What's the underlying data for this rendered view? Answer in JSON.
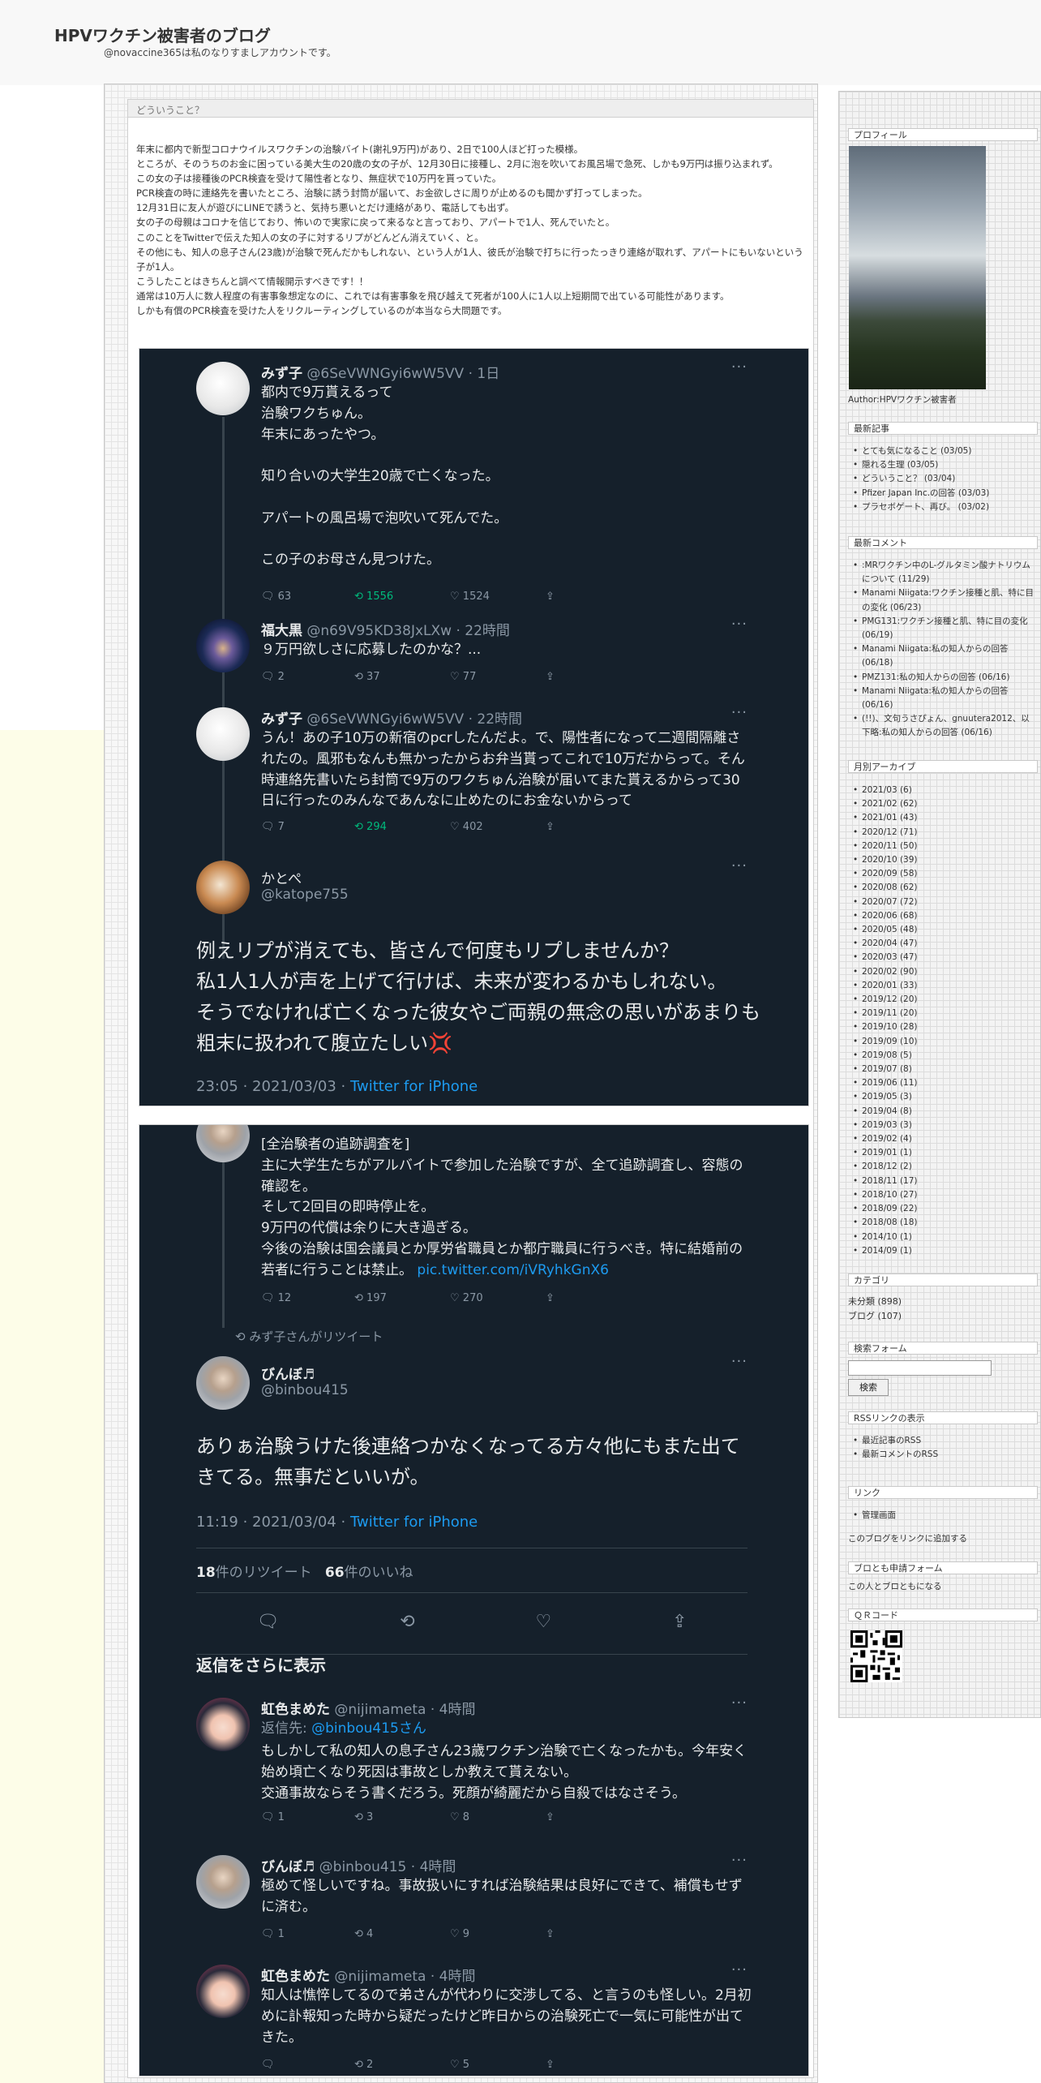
{
  "site": {
    "title": "HPVワクチン被害者のブログ",
    "subtitle": "@novaccine365は私のなりすましアカウントです。"
  },
  "entry": {
    "title": "どういうこと？",
    "paragraphs": [
      "年末に都内で新型コロナウイルスワクチンの治験バイト(謝礼9万円)があり、2日で100人ほど打った模様。",
      "ところが、そのうちのお金に困っている美大生の20歳の女の子が、12月30日に接種し、2月に泡を吹いてお風呂場で急死、しかも9万円は振り込まれず。",
      "この女の子は接種後のPCR検査を受けて陽性者となり、無症状で10万円を貰っていた。",
      "PCR検査の時に連絡先を書いたところ、治験に誘う封筒が届いて、お金欲しさに周りが止めるのも聞かず打ってしまった。",
      "12月31日に友人が遊びにLINEで誘うと、気持ち悪いとだけ連絡があり、電話しても出ず。",
      "女の子の母親はコロナを信じており、怖いので実家に戻って来るなと言っており、アパートで1人、死んでいたと。",
      "このことをTwitterで伝えた知人の女の子に対するリプがどんどん消えていく、と。",
      "その他にも、知人の息子さん(23歳)が治験で死んだかもしれない、という人が1人、彼氏が治験で打ちに行ったっきり連絡が取れず、アパートにもいないという子が1人。",
      "こうしたことはきちんと調べて情報開示すべきです！！",
      "通常は10万人に数人程度の有害事象想定なのに、これでは有害事象を飛び越えて死者が100人に1人以上短期間で出ている可能性があります。",
      "しかも有償のPCR検査を受けた人をリクルーティングしているのが本当なら大問題です。"
    ]
  },
  "shot1": {
    "t1": {
      "name": "みず子",
      "handle": "@6SeVWNGyi6wW5VV",
      "time": "· 1日",
      "text": "都内で9万貰えるって\n治験ワクちゅん。\n年末にあったやつ。\n\n知り合いの大学生20歳で亡くなった。\n\nアパートの風呂場で泡吹いて死んでた。\n\nこの子のお母さん見つけた。",
      "replies": "63",
      "retweets": "1556",
      "likes": "1524"
    },
    "t2": {
      "name": "福大黒",
      "handle": "@n69V95KD38JxLXw",
      "time": "· 22時間",
      "text": "９万円欲しさに応募したのかな？...",
      "replies": "2",
      "retweets": "37",
      "likes": "77"
    },
    "t3": {
      "name": "みず子",
      "handle": "@6SeVWNGyi6wW5VV",
      "time": "· 22時間",
      "text": "うん！あの子10万の新宿のpcrしたんだよ。で、陽性者になって二週間隔離されたの。風邪もなんも無かったからお弁当貰ってこれで10万だからって。そん時連絡先書いたら封筒で9万のワクちゅん治験が届いてまた貰えるからって30日に行ったのみんなであんなに止めたのにお金ないからって",
      "replies": "7",
      "retweets": "294",
      "likes": "402"
    },
    "main": {
      "name": "かとぺ",
      "handle": "@katope755",
      "text": "例えリプが消えても、皆さんで何度もリプしませんか？\n私1人1人が声を上げて行けば、未来が変わるかもしれない。\nそうでなければ亡くなった彼女やご両親の無念の思いがあまりも粗末に扱われて腹立たしい💢",
      "timestamp": "23:05 · 2021/03/03 · ",
      "source": "Twitter for iPhone"
    }
  },
  "shot2": {
    "t1": {
      "text": "[全治験者の追跡調査を]\n主に大学生たちがアルバイトで参加した治験ですが、全て追跡調査し、容態の確認を。\nそして2回目の即時停止を。\n9万円の代償は余りに大き過ぎる。\n今後の治験は国会議員とか厚労省職員とか都庁職員に行うべき。特に結婚前の若者に行うことは禁止。 ",
      "link": "pic.twitter.com/iVRyhkGnX6",
      "replies": "12",
      "retweets": "197",
      "likes": "270"
    },
    "retweet_note": "みず子さんがリツイート",
    "main": {
      "name": "びんぼ♬",
      "handle": "@binbou415",
      "text": "ありぁ治験うけた後連絡つかなくなってる方々他にもまた出てきてる。無事だといいが。",
      "timestamp": "11:19 · 2021/03/04 · ",
      "source": "Twitter for iPhone",
      "rt_count": "18",
      "rt_label": "件のリツイート",
      "like_count": "66",
      "like_label": "件のいいね"
    },
    "more_replies": "返信をさらに表示",
    "r1": {
      "name": "虹色まめた",
      "handle": "@nijimameta",
      "time": "· 4時間",
      "reply_to_label": "返信先: ",
      "reply_to": "@binbou415さん",
      "text": "もしかして私の知人の息子さん23歳ワクチン治験で亡くなったかも。今年安く始め頃亡くなり死因は事故としか教えて貰えない。\n交通事故ならそう書くだろう。死顔が綺麗だから自殺ではなさそう。",
      "replies": "1",
      "retweets": "3",
      "likes": "8"
    },
    "r2": {
      "name": "びんぼ♬",
      "handle": "@binbou415",
      "time": "· 4時間",
      "text": "極めて怪しいですね。事故扱いにすれば治験結果は良好にできて、補償もせずに済む。",
      "replies": "1",
      "retweets": "4",
      "likes": "9"
    },
    "r3": {
      "name": "虹色まめた",
      "handle": "@nijimameta",
      "time": "· 4時間",
      "text": "知人は憔悴してるので弟さんが代わりに交渉してる、と言うのも怪しい。2月初めに訃報知った時から疑だったけど昨日からの治験死亡で一気に可能性が出てきた。",
      "replies": "",
      "retweets": "2",
      "likes": "5"
    }
  },
  "sidebar": {
    "profile": {
      "heading": "プロフィール",
      "author": "Author:HPVワクチン被害者"
    },
    "recent_posts": {
      "heading": "最新記事",
      "items": [
        "とても気になること (03/05)",
        "隠れる生理 (03/05)",
        "どういうこと？ (03/04)",
        "Pfizer Japan Inc.の回答 (03/03)",
        "プラセボゲート、再び。 (03/02)"
      ]
    },
    "recent_comments": {
      "heading": "最新コメント",
      "items": [
        ":MRワクチン中のL-グルタミン酸ナトリウムについて (11/29)",
        "Manami Niigata:ワクチン接種と肌、特に目の変化 (06/23)",
        "PMG131:ワクチン接種と肌、特に目の変化 (06/19)",
        "Manami Niigata:私の知人からの回答 (06/18)",
        "PMZ131:私の知人からの回答 (06/16)",
        "Manami Niigata:私の知人からの回答 (06/16)",
        "(!!)、文句うさぴょん、gnuutera2012、以下略:私の知人からの回答 (06/16)"
      ]
    },
    "archive": {
      "heading": "月別アーカイブ",
      "items": [
        "2021/03 (6)",
        "2021/02 (62)",
        "2021/01 (43)",
        "2020/12 (71)",
        "2020/11 (50)",
        "2020/10 (39)",
        "2020/09 (58)",
        "2020/08 (62)",
        "2020/07 (72)",
        "2020/06 (68)",
        "2020/05 (48)",
        "2020/04 (47)",
        "2020/03 (47)",
        "2020/02 (90)",
        "2020/01 (33)",
        "2019/12 (20)",
        "2019/11 (20)",
        "2019/10 (28)",
        "2019/09 (10)",
        "2019/08 (5)",
        "2019/07 (8)",
        "2019/06 (11)",
        "2019/05 (3)",
        "2019/04 (8)",
        "2019/03 (3)",
        "2019/02 (4)",
        "2019/01 (1)",
        "2018/12 (2)",
        "2018/11 (17)",
        "2018/10 (27)",
        "2018/09 (22)",
        "2018/08 (18)",
        "2014/10 (1)",
        "2014/09 (1)"
      ]
    },
    "category": {
      "heading": "カテゴリ",
      "items": [
        "未分類 (898)",
        "ブログ (107)"
      ]
    },
    "search": {
      "heading": "検索フォーム",
      "button": "検索"
    },
    "rss": {
      "heading": "RSSリンクの表示",
      "items": [
        "最近記事のRSS",
        "最新コメントのRSS"
      ]
    },
    "links": {
      "heading": "リンク",
      "items": [
        "管理画面"
      ],
      "add": "このブログをリンクに追加する"
    },
    "friend": {
      "heading": "ブロとも申請フォーム",
      "text": "この人とブロともになる"
    },
    "qr": {
      "heading": "ＱＲコード"
    }
  }
}
